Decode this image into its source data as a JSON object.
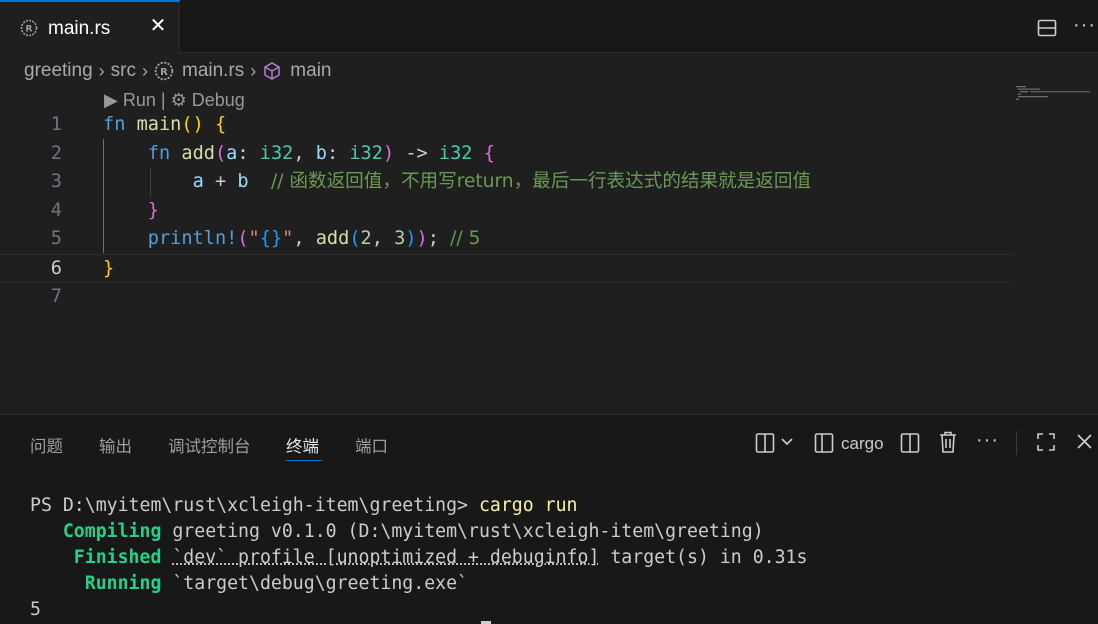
{
  "tab": {
    "label": "main.rs",
    "close": "✕",
    "icon": "rust-icon"
  },
  "toolbar": {
    "more": "···"
  },
  "breadcrumb": {
    "items": [
      "greeting",
      "src",
      "main.rs",
      "main"
    ]
  },
  "codelens": {
    "run": "Run",
    "sep": "|",
    "debug": "Debug"
  },
  "editor": {
    "line_numbers": [
      "1",
      "2",
      "3",
      "4",
      "5",
      "6",
      "7"
    ],
    "active_line": "6"
  },
  "panel": {
    "tabs": [
      "问题",
      "输出",
      "调试控制台",
      "终端",
      "端口"
    ],
    "active_tab": "终端",
    "terminal_name": "cargo",
    "more": "···"
  },
  "terminal": {
    "prompt": "PS D:\\myitem\\rust\\xcleigh-item\\greeting> ",
    "command": "cargo run",
    "lines": [
      {
        "label": "   Compiling",
        "text": " greeting v0.1.0 (D:\\myitem\\rust\\xcleigh-item\\greeting)"
      },
      {
        "label": "    Finished",
        "text_pre": " ",
        "text_ul": "`dev` profile [unoptimized + debuginfo]",
        "text_post": " target(s) in 0.31s"
      },
      {
        "label": "     Running",
        "text": " `target\\debug\\greeting.exe`"
      }
    ],
    "output": "5"
  },
  "colors": {
    "accent": "#0078d4",
    "keyword": "#569cd6",
    "function": "#dcdcaa",
    "type": "#4ec9b0",
    "comment": "#6a9955",
    "terminal_green": "#23d18b"
  }
}
